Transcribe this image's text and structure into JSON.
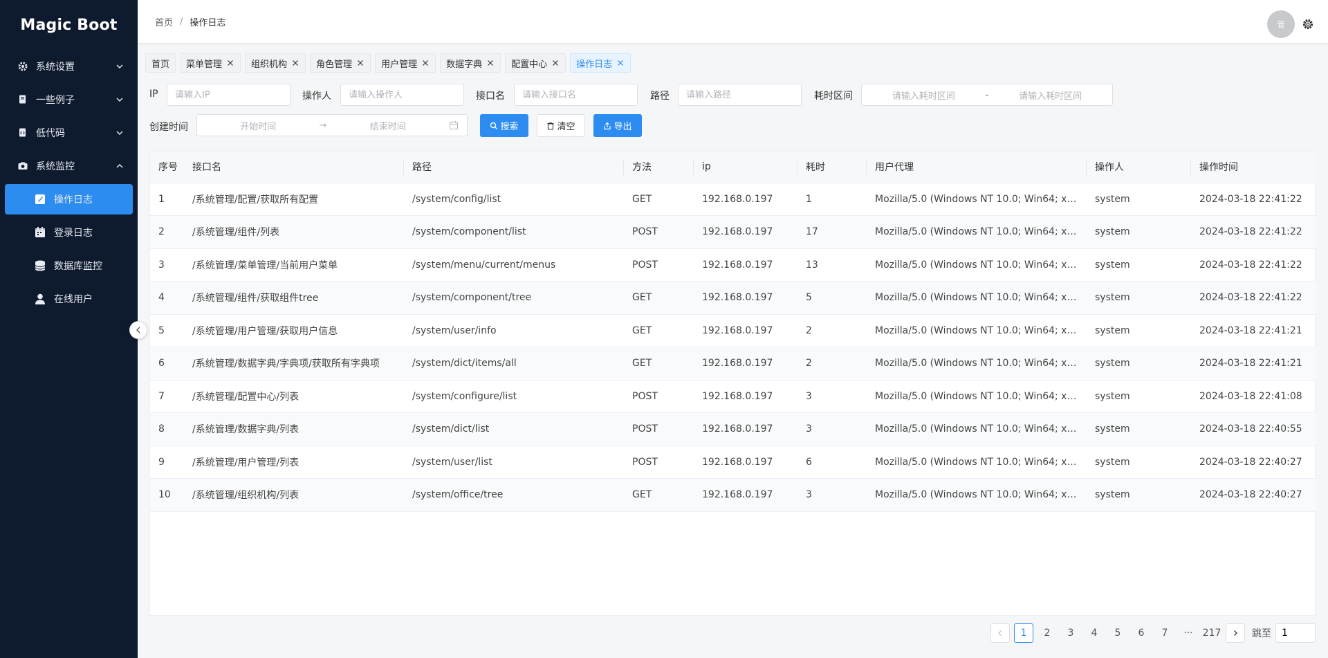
{
  "app": {
    "logo": "Magic Boot"
  },
  "sidebar": {
    "items": [
      {
        "label": "系统设置",
        "icon": "gear-icon",
        "expanded": false
      },
      {
        "label": "一些例子",
        "icon": "document-icon",
        "expanded": false
      },
      {
        "label": "低代码",
        "icon": "code-file-icon",
        "expanded": false
      },
      {
        "label": "系统监控",
        "icon": "camera-icon",
        "expanded": true
      }
    ],
    "subitems": [
      {
        "label": "操作日志",
        "icon": "edit-icon",
        "active": true
      },
      {
        "label": "登录日志",
        "icon": "calendar-icon",
        "active": false
      },
      {
        "label": "数据库监控",
        "icon": "database-icon",
        "active": false
      },
      {
        "label": "在线用户",
        "icon": "user-icon",
        "active": false
      }
    ]
  },
  "header": {
    "breadcrumb": [
      "首页",
      "操作日志"
    ],
    "breadcrumb_sep": "/",
    "avatar_text": "管"
  },
  "tabs": [
    {
      "label": "首页",
      "closable": false,
      "active": false
    },
    {
      "label": "菜单管理",
      "closable": true,
      "active": false
    },
    {
      "label": "组织机构",
      "closable": true,
      "active": false
    },
    {
      "label": "角色管理",
      "closable": true,
      "active": false
    },
    {
      "label": "用户管理",
      "closable": true,
      "active": false
    },
    {
      "label": "数据字典",
      "closable": true,
      "active": false
    },
    {
      "label": "配置中心",
      "closable": true,
      "active": false
    },
    {
      "label": "操作日志",
      "closable": true,
      "active": true
    }
  ],
  "filters": {
    "ip_label": "IP",
    "ip_placeholder": "请输入IP",
    "operator_label": "操作人",
    "operator_placeholder": "请输入操作人",
    "api_label": "接口名",
    "api_placeholder": "请输入接口名",
    "path_label": "路径",
    "path_placeholder": "请输入路径",
    "cost_label": "耗时区间",
    "cost_from_placeholder": "请输入耗时区间",
    "cost_sep": "-",
    "cost_to_placeholder": "请输入耗时区间",
    "created_label": "创建时间",
    "start_placeholder": "开始时间",
    "range_arrow": "→",
    "end_placeholder": "结束时间",
    "search_btn": "搜索",
    "clear_btn": "清空",
    "export_btn": "导出"
  },
  "table": {
    "columns": [
      "序号",
      "接口名",
      "路径",
      "方法",
      "ip",
      "耗时",
      "用户代理",
      "操作人",
      "操作时间"
    ],
    "rows": [
      [
        "1",
        "/系统管理/配置/获取所有配置",
        "/system/config/list",
        "GET",
        "192.168.0.197",
        "1",
        "Mozilla/5.0 (Windows NT 10.0; Win64; x64...",
        "system",
        "2024-03-18 22:41:22"
      ],
      [
        "2",
        "/系统管理/组件/列表",
        "/system/component/list",
        "POST",
        "192.168.0.197",
        "17",
        "Mozilla/5.0 (Windows NT 10.0; Win64; x64...",
        "system",
        "2024-03-18 22:41:22"
      ],
      [
        "3",
        "/系统管理/菜单管理/当前用户菜单",
        "/system/menu/current/menus",
        "POST",
        "192.168.0.197",
        "13",
        "Mozilla/5.0 (Windows NT 10.0; Win64; x64...",
        "system",
        "2024-03-18 22:41:22"
      ],
      [
        "4",
        "/系统管理/组件/获取组件tree",
        "/system/component/tree",
        "GET",
        "192.168.0.197",
        "5",
        "Mozilla/5.0 (Windows NT 10.0; Win64; x64...",
        "system",
        "2024-03-18 22:41:22"
      ],
      [
        "5",
        "/系统管理/用户管理/获取用户信息",
        "/system/user/info",
        "GET",
        "192.168.0.197",
        "2",
        "Mozilla/5.0 (Windows NT 10.0; Win64; x64...",
        "system",
        "2024-03-18 22:41:21"
      ],
      [
        "6",
        "/系统管理/数据字典/字典项/获取所有字典项",
        "/system/dict/items/all",
        "GET",
        "192.168.0.197",
        "2",
        "Mozilla/5.0 (Windows NT 10.0; Win64; x64...",
        "system",
        "2024-03-18 22:41:21"
      ],
      [
        "7",
        "/系统管理/配置中心/列表",
        "/system/configure/list",
        "POST",
        "192.168.0.197",
        "3",
        "Mozilla/5.0 (Windows NT 10.0; Win64; x64...",
        "system",
        "2024-03-18 22:41:08"
      ],
      [
        "8",
        "/系统管理/数据字典/列表",
        "/system/dict/list",
        "POST",
        "192.168.0.197",
        "3",
        "Mozilla/5.0 (Windows NT 10.0; Win64; x64...",
        "system",
        "2024-03-18 22:40:55"
      ],
      [
        "9",
        "/系统管理/用户管理/列表",
        "/system/user/list",
        "POST",
        "192.168.0.197",
        "6",
        "Mozilla/5.0 (Windows NT 10.0; Win64; x64...",
        "system",
        "2024-03-18 22:40:27"
      ],
      [
        "10",
        "/系统管理/组织机构/列表",
        "/system/office/tree",
        "GET",
        "192.168.0.197",
        "3",
        "Mozilla/5.0 (Windows NT 10.0; Win64; x64...",
        "system",
        "2024-03-18 22:40:27"
      ]
    ]
  },
  "pagination": {
    "pages": [
      "1",
      "2",
      "3",
      "4",
      "5",
      "6",
      "7",
      "···",
      "217"
    ],
    "current": "1",
    "jump_label": "跳至",
    "jump_value": "1"
  },
  "colors": {
    "sidebar_bg": "#0e1a2d",
    "accent": "#2d8cf0"
  }
}
